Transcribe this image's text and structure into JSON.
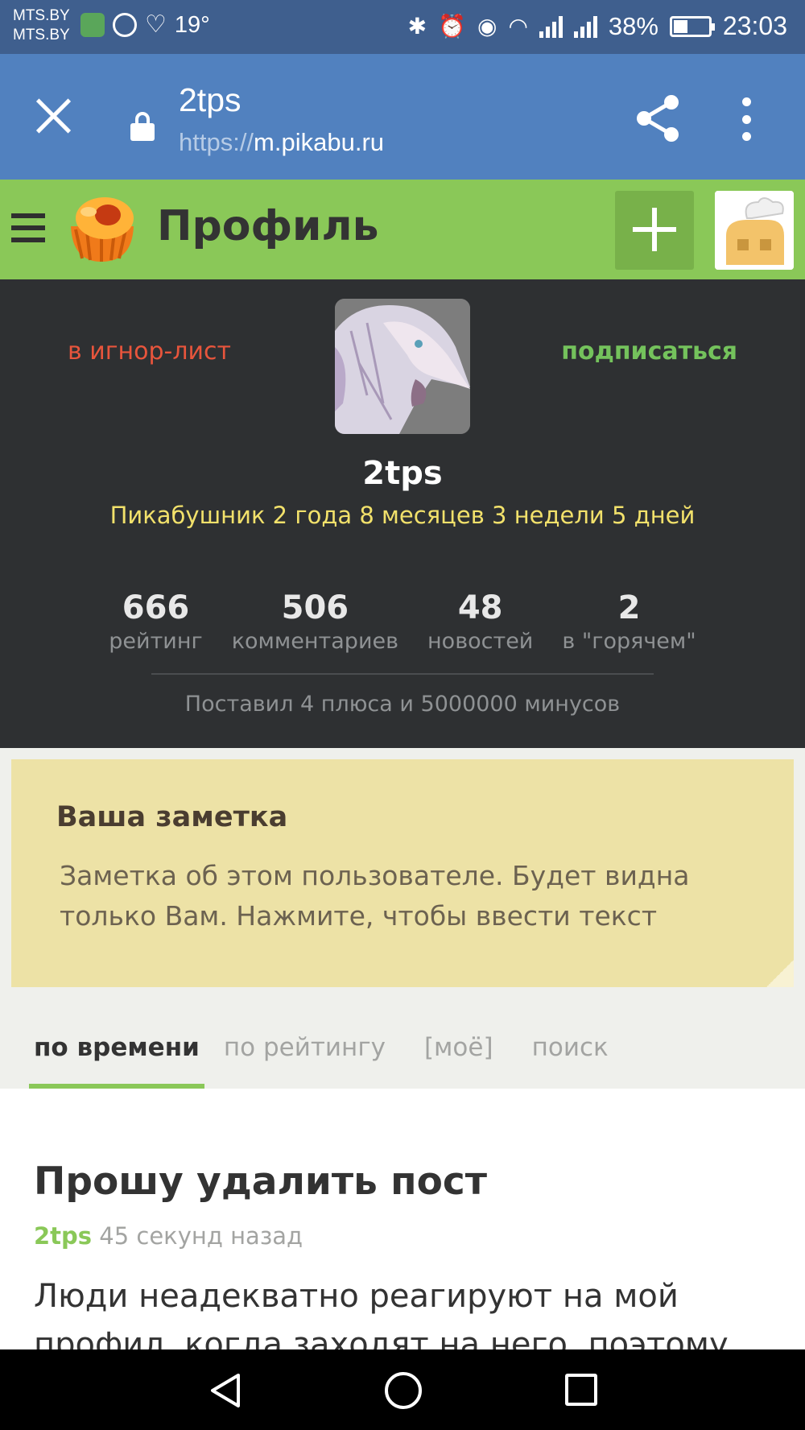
{
  "status_bar": {
    "carrier_1": "MTS.BY",
    "carrier_2": "MTS.BY",
    "temperature": "19°",
    "battery": "38%",
    "time": "23:03"
  },
  "browser": {
    "title": "2tps",
    "url_scheme": "https://",
    "url_host": "m.pikabu.ru"
  },
  "site_header": {
    "title": "Профиль"
  },
  "profile": {
    "ignore_label": "в игнор-лист",
    "subscribe_label": "подписаться",
    "username": "2tps",
    "membership": "Пикабушник 2 года 8 месяцев 3 недели 5 дней",
    "stats": [
      {
        "value": "666",
        "label": "рейтинг"
      },
      {
        "value": "506",
        "label": "комментариев"
      },
      {
        "value": "48",
        "label": "новостей"
      },
      {
        "value": "2",
        "label": "в \"горячем\""
      }
    ],
    "votes": "Поставил 4 плюса и 5000000 минусов"
  },
  "note": {
    "title": "Ваша заметка",
    "placeholder": "Заметка об этом пользователе. Будет видна только Вам. Нажмите, чтобы ввести текст"
  },
  "sort_tabs": [
    {
      "label": "по времени",
      "active": true
    },
    {
      "label": "по рейтингу",
      "active": false
    },
    {
      "label": "[моё]",
      "active": false
    },
    {
      "label": "поиск",
      "active": false
    }
  ],
  "post": {
    "title": "Прошу удалить пост",
    "author": "2tps",
    "time": "45 секунд назад",
    "body": "Люди неадекватно реагируют на мой профил, когда заходят на него, поэтому"
  },
  "colors": {
    "header_green": "#8ac858",
    "browser_blue": "#5181bf",
    "profile_dark": "#2e3032",
    "ignore_red": "#e8553c",
    "membership_yellow": "#f2e16b",
    "note_yellow": "#ede2a6"
  }
}
